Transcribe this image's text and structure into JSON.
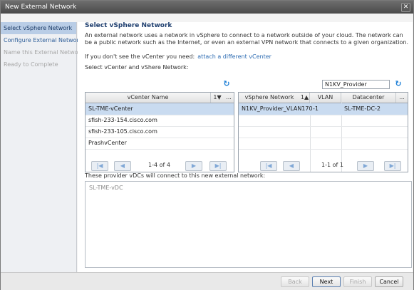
{
  "window": {
    "title": "New External Network"
  },
  "steps": [
    {
      "label": "Select vSphere Network",
      "state": "active"
    },
    {
      "label": "Configure External Network",
      "state": "link"
    },
    {
      "label": "Name this External Network",
      "state": "disabled"
    },
    {
      "label": "Ready to Complete",
      "state": "disabled"
    }
  ],
  "main": {
    "heading": "Select vSphere Network",
    "description": "An external network uses a network in vSphere to connect to a network outside of your cloud. The network can be a public network such as the Internet, or even an external VPN network that connects to a given organization.",
    "hint": "If you don't see the vCenter you need:",
    "hint_link": "attach a different vCenter",
    "select_label": "Select vCenter and vShere Network:",
    "filter_value": "N1KV_Provider"
  },
  "vcenter_table": {
    "column_header": "vCenter Name",
    "sort_indicator": "1▼",
    "more": "...",
    "rows": [
      "SL-TME-vCenter",
      "sfish-233-154.cisco.com",
      "sfish-233-105.cisco.com",
      "PrashvCenter"
    ],
    "pager_text": "1-4 of 4"
  },
  "network_table": {
    "columns": [
      "vSphere Network",
      "VLAN",
      "Datacenter"
    ],
    "sort_indicator": "1▲",
    "more": "...",
    "rows": [
      {
        "network": "N1KV_Provider_VLAN170",
        "vlan": "-1",
        "datacenter": "SL-TME-DC-2"
      }
    ],
    "pager_text": "1-1 of 1"
  },
  "vdc": {
    "label": "These provider vDCs will connect to this new external network:",
    "items": [
      "SL-TME-vDC"
    ]
  },
  "footer": {
    "back": "Back",
    "next": "Next",
    "finish": "Finish",
    "cancel": "Cancel"
  },
  "icons": {
    "close": "close-icon",
    "refresh": "refresh-icon",
    "first": "first-page-icon",
    "prev": "prev-page-icon",
    "next": "next-page-icon",
    "last": "last-page-icon"
  }
}
